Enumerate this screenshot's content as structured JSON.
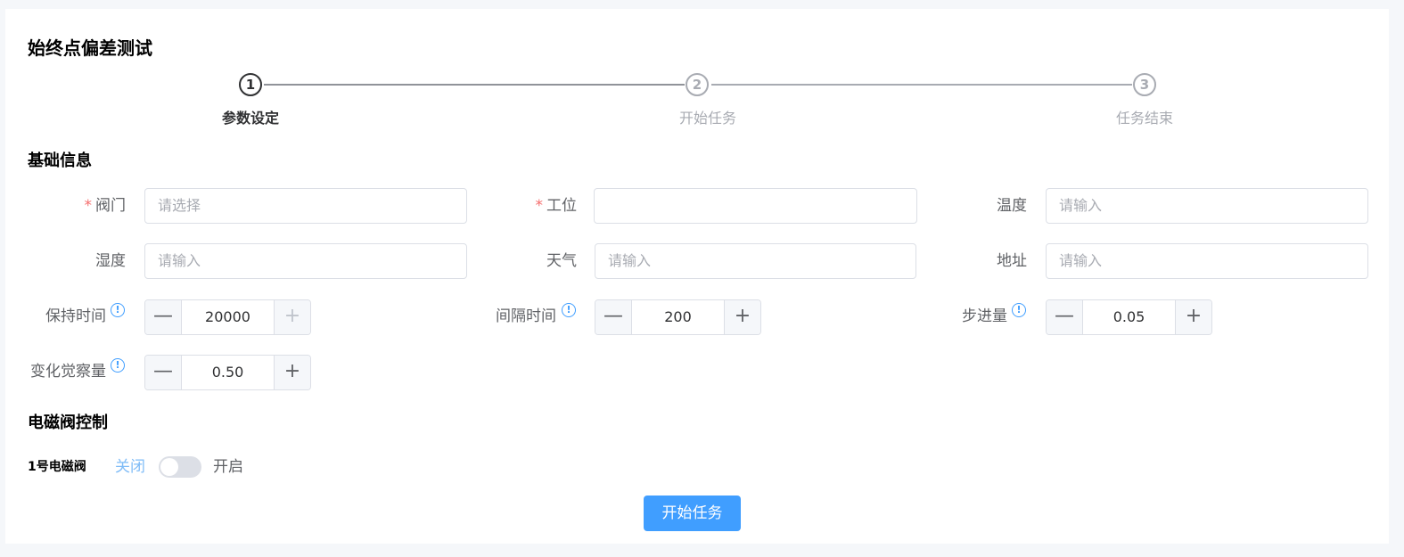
{
  "page": {
    "title": "始终点偏差测试"
  },
  "steps": [
    {
      "number": "1",
      "label": "参数设定",
      "status": "active"
    },
    {
      "number": "2",
      "label": "开始任务",
      "status": "wait"
    },
    {
      "number": "3",
      "label": "任务结束",
      "status": "wait"
    }
  ],
  "basic_info": {
    "section_title": "基础信息",
    "valve": {
      "label": "阀门",
      "required_mark": "*",
      "placeholder": "请选择",
      "value": ""
    },
    "station": {
      "label": "工位",
      "required_mark": "*",
      "placeholder": "",
      "value": ""
    },
    "temperature": {
      "label": "温度",
      "placeholder": "请输入",
      "value": ""
    },
    "humidity": {
      "label": "湿度",
      "placeholder": "请输入",
      "value": ""
    },
    "weather": {
      "label": "天气",
      "placeholder": "请输入",
      "value": ""
    },
    "address": {
      "label": "地址",
      "placeholder": "请输入",
      "value": ""
    },
    "hold_time": {
      "label": "保持时间",
      "value": "20000"
    },
    "interval_time": {
      "label": "间隔时间",
      "value": "200"
    },
    "step_amount": {
      "label": "步进量",
      "value": "0.05"
    },
    "change_sensitivity": {
      "label": "变化觉察量",
      "value": "0.50"
    },
    "info_glyph": "!",
    "minus_glyph": "—",
    "plus_glyph": "+"
  },
  "solenoid": {
    "section_title": "电磁阀控制",
    "valve1": {
      "label": "1号电磁阀",
      "off_text": "关闭",
      "on_text": "开启",
      "state": "off"
    }
  },
  "actions": {
    "start_label": "开始任务"
  },
  "colors": {
    "primary": "#409eff",
    "danger": "#f56c6c",
    "background": "#f5f7fa"
  }
}
